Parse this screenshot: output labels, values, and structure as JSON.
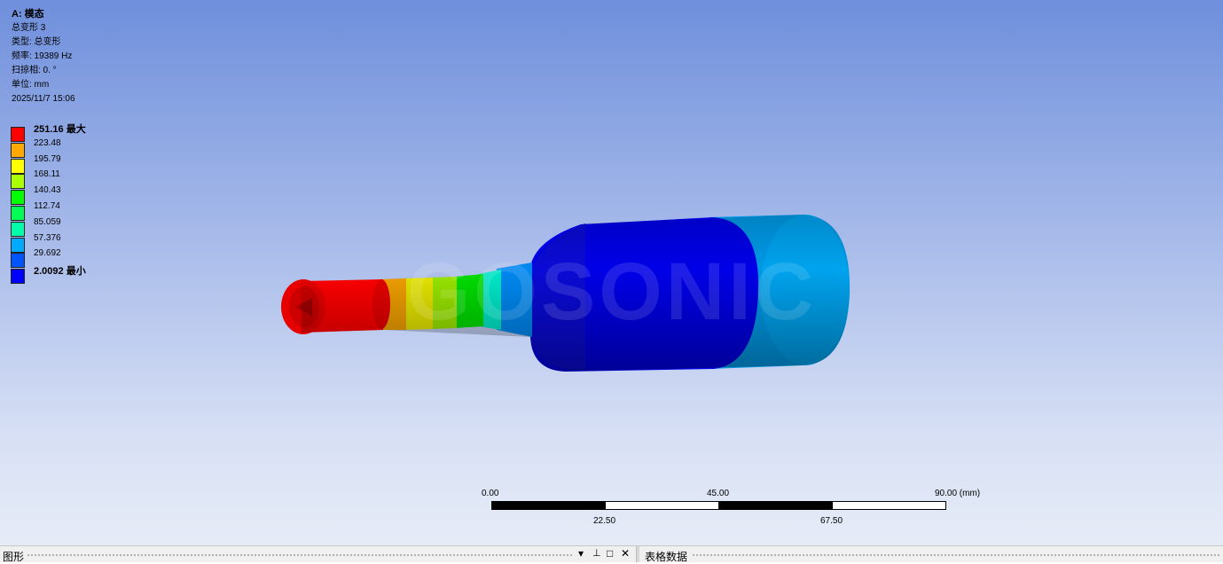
{
  "info": {
    "title": "A: 模态",
    "result": "总变形 3",
    "type": "类型: 总变形",
    "frequency": "频率: 19389    Hz",
    "sweep": "扫掠相: 0. °",
    "unit": "单位: mm",
    "date": "2025/11/7 15:06"
  },
  "legend": {
    "items": [
      {
        "label": "251.16 最大",
        "color": "#ff0000",
        "bold": true
      },
      {
        "label": "223.48",
        "color": "#ffaa00"
      },
      {
        "label": "195.79",
        "color": "#ffff00"
      },
      {
        "label": "168.11",
        "color": "#aaff00"
      },
      {
        "label": "140.43",
        "color": "#00ff00"
      },
      {
        "label": "112.74",
        "color": "#00ff55"
      },
      {
        "label": "85.059",
        "color": "#00ffaa"
      },
      {
        "label": "57.376",
        "color": "#00aaff"
      },
      {
        "label": "29.692",
        "color": "#0055ff"
      },
      {
        "label": "2.0092 最小",
        "color": "#0000ff",
        "bold": true
      }
    ]
  },
  "watermark": "GOSONIC",
  "scale": {
    "top": [
      "0.00",
      "45.00",
      "90.00 (mm)"
    ],
    "bottom": [
      "22.50",
      "67.50"
    ]
  },
  "bottombar": {
    "left_title": "图形",
    "right_title": "表格数据",
    "dropdown_icon": "▾",
    "pin_icon": "🗙",
    "restore_icon": "□",
    "close_icon": "✕"
  },
  "colors": {
    "max": "#ff0000",
    "min": "#0000ff",
    "mid": "#00ff00"
  }
}
